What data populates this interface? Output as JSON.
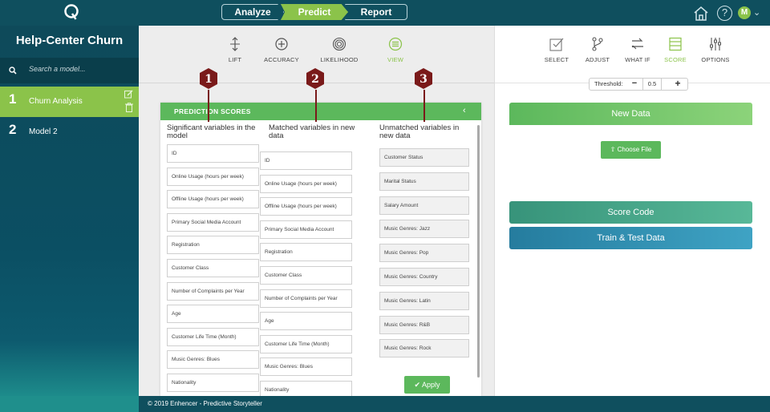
{
  "app": {
    "logo": "Q"
  },
  "steps": [
    "Analyze",
    "Predict",
    "Report"
  ],
  "header_icons": {
    "home": "home-icon",
    "help": "?",
    "avatar": "M"
  },
  "sidebar": {
    "project_title": "Help-Center Churn",
    "search_placeholder": "Search a model...",
    "models": [
      {
        "num": "1",
        "label": "Churn Analysis"
      },
      {
        "num": "2",
        "label": "Model 2"
      }
    ]
  },
  "center_toolbar": [
    "LIFT",
    "ACCURACY",
    "LIKELIHOOD",
    "VIEW"
  ],
  "scores": {
    "title": "PREDICTION SCORES",
    "col1_head": "Significant variables in the model",
    "col2_head": "Matched variables in new data",
    "col3_head": "Unmatched variables in new data",
    "col1": [
      "ID",
      "Online Usage (hours per week)",
      "Offline Usage (hours per week)",
      "Primary Social Media Account",
      "Registration",
      "Customer Class",
      "Number of Complaints per Year",
      "Age",
      "Customer Life Time (Month)",
      "Music Genres: Blues",
      "Nationality"
    ],
    "col2": [
      "ID",
      "Online Usage (hours per week)",
      "Offline Usage (hours per week)",
      "Primary Social Media Account",
      "Registration",
      "Customer Class",
      "Number of Complaints per Year",
      "Age",
      "Customer Life Time (Month)",
      "Music Genres: Blues",
      "Nationality"
    ],
    "col3": [
      "Customer Status",
      "Marital Status",
      "Salary Amount",
      "Music Genres: Jazz",
      "Music Genres: Pop",
      "Music Genres: Country",
      "Music Genres: Latin",
      "Music Genres: R&B",
      "Music Genres: Rock"
    ],
    "apply": "Apply"
  },
  "markers": [
    "1",
    "2",
    "3"
  ],
  "right_toolbar": [
    "SELECT",
    "ADJUST",
    "WHAT IF",
    "SCORE",
    "OPTIONS"
  ],
  "threshold": {
    "label": "Threshold:",
    "value": "0.5",
    "minus": "−",
    "plus": "+"
  },
  "right_panel": {
    "new_data": "New Data",
    "choose_file": "Choose File",
    "score_code": "Score Code",
    "train_test": "Train & Test Data"
  },
  "footer": "© 2019 Enhencer -  Predictive Storyteller",
  "colors": {
    "brand_dark": "#0f4f5e",
    "accent_green": "#8bc34a",
    "panel_green": "#5cb85c",
    "marker": "#7a1a1a"
  }
}
